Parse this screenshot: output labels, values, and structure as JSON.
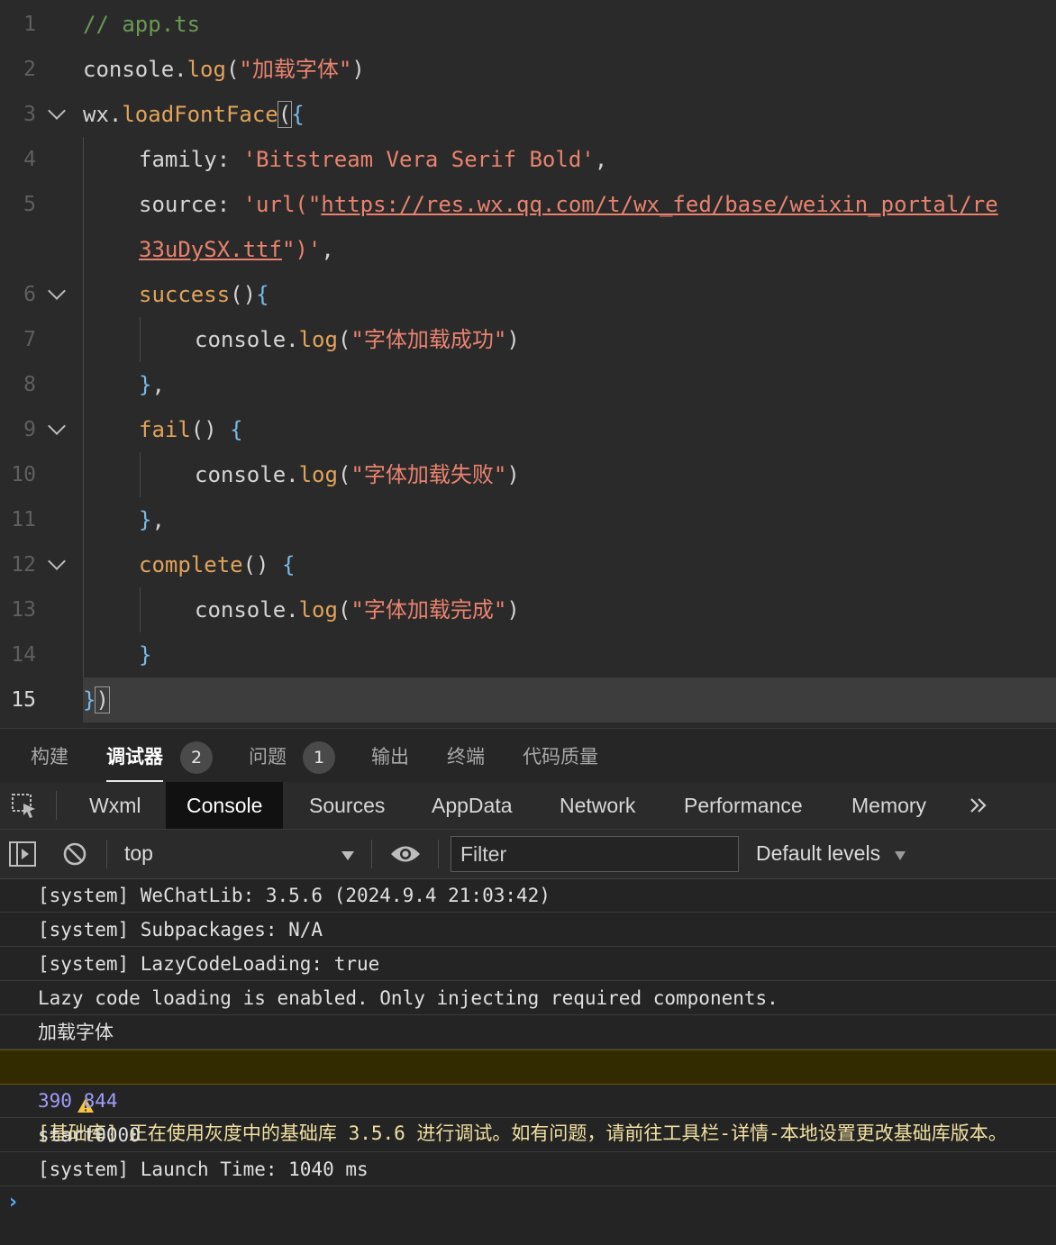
{
  "editor": {
    "lines": [
      {
        "n": "1",
        "parts": [
          {
            "t": "// app.ts",
            "c": "c-comment"
          }
        ]
      },
      {
        "n": "2",
        "parts": [
          {
            "t": "console.",
            "c": "c-plain"
          },
          {
            "t": "log",
            "c": "c-fn"
          },
          {
            "t": "(",
            "c": "c-plain"
          },
          {
            "t": "\"加载字体\"",
            "c": "c-str"
          },
          {
            "t": ")",
            "c": "c-plain"
          }
        ]
      },
      {
        "n": "3",
        "parts": [
          {
            "t": "wx.",
            "c": "c-plain"
          },
          {
            "t": "loadFontFace",
            "c": "c-fn"
          },
          {
            "t": "(",
            "c": "c-plain"
          },
          {
            "t": "{",
            "c": "c-brace"
          }
        ]
      },
      {
        "n": "4",
        "parts": [
          {
            "t": "family: ",
            "c": "c-plain"
          },
          {
            "t": "'Bitstream Vera Serif Bold'",
            "c": "c-str"
          },
          {
            "t": ",",
            "c": "c-plain"
          }
        ]
      },
      {
        "n": "5",
        "parts": [
          {
            "t": "source: ",
            "c": "c-plain"
          },
          {
            "t": "'url(\"",
            "c": "c-str"
          },
          {
            "t": "https://res.wx.qq.com/t/wx_fed/base/weixin_portal/re",
            "c": "c-link"
          }
        ]
      },
      {
        "n": "",
        "parts": [
          {
            "t": "33uDySX.ttf",
            "c": "c-link"
          },
          {
            "t": "\")'",
            "c": "c-str"
          },
          {
            "t": ",",
            "c": "c-plain"
          }
        ]
      },
      {
        "n": "6",
        "parts": [
          {
            "t": "success",
            "c": "c-fn"
          },
          {
            "t": "()",
            "c": "c-plain"
          },
          {
            "t": "{",
            "c": "c-brace"
          }
        ]
      },
      {
        "n": "7",
        "parts": [
          {
            "t": "console.",
            "c": "c-plain"
          },
          {
            "t": "log",
            "c": "c-fn"
          },
          {
            "t": "(",
            "c": "c-plain"
          },
          {
            "t": "\"字体加载成功\"",
            "c": "c-str"
          },
          {
            "t": ")",
            "c": "c-plain"
          }
        ]
      },
      {
        "n": "8",
        "parts": [
          {
            "t": "}",
            "c": "c-brace"
          },
          {
            "t": ",",
            "c": "c-plain"
          }
        ]
      },
      {
        "n": "9",
        "parts": [
          {
            "t": "fail",
            "c": "c-fn"
          },
          {
            "t": "() ",
            "c": "c-plain"
          },
          {
            "t": "{",
            "c": "c-brace"
          }
        ]
      },
      {
        "n": "10",
        "parts": [
          {
            "t": "console.",
            "c": "c-plain"
          },
          {
            "t": "log",
            "c": "c-fn"
          },
          {
            "t": "(",
            "c": "c-plain"
          },
          {
            "t": "\"字体加载失败\"",
            "c": "c-str"
          },
          {
            "t": ")",
            "c": "c-plain"
          }
        ]
      },
      {
        "n": "11",
        "parts": [
          {
            "t": "}",
            "c": "c-brace"
          },
          {
            "t": ",",
            "c": "c-plain"
          }
        ]
      },
      {
        "n": "12",
        "parts": [
          {
            "t": "complete",
            "c": "c-fn"
          },
          {
            "t": "() ",
            "c": "c-plain"
          },
          {
            "t": "{",
            "c": "c-brace"
          }
        ]
      },
      {
        "n": "13",
        "parts": [
          {
            "t": "console.",
            "c": "c-plain"
          },
          {
            "t": "log",
            "c": "c-fn"
          },
          {
            "t": "(",
            "c": "c-plain"
          },
          {
            "t": "\"字体加载完成\"",
            "c": "c-str"
          },
          {
            "t": ")",
            "c": "c-plain"
          }
        ]
      },
      {
        "n": "14",
        "parts": [
          {
            "t": "}",
            "c": "c-brace"
          }
        ]
      },
      {
        "n": "15",
        "parts": [
          {
            "t": "}",
            "c": "c-brace"
          },
          {
            "t": ")",
            "c": "c-plain"
          }
        ]
      }
    ]
  },
  "panel_tabs": [
    {
      "label": "构建"
    },
    {
      "label": "调试器",
      "badge": "2"
    },
    {
      "label": "问题",
      "badge": "1"
    },
    {
      "label": "输出"
    },
    {
      "label": "终端"
    },
    {
      "label": "代码质量"
    }
  ],
  "devtools_tabs": [
    "Wxml",
    "Console",
    "Sources",
    "AppData",
    "Network",
    "Performance",
    "Memory"
  ],
  "toolbar": {
    "context": "top",
    "filter_placeholder": "Filter",
    "levels": "Default levels"
  },
  "console": [
    "[system] WeChatLib: 3.5.6 (2024.9.4 21:03:42)",
    "[system] Subpackages: N/A",
    "[system] LazyCodeLoading: true",
    "Lazy code loading is enabled. Only injecting required components.",
    "加载字体",
    "[基础库] 正在使用灰度中的基础库 3.5.6 进行调试。如有问题，请前往工具栏-详情-本地设置更改基础库版本。",
    "390 844",
    "start0000",
    "[system] Launch Time: 1040 ms"
  ],
  "colors": {
    "accent_blue": "#5aa8f5",
    "warning_yellow": "#f5c542",
    "number_purple": "#9f9cf9"
  }
}
